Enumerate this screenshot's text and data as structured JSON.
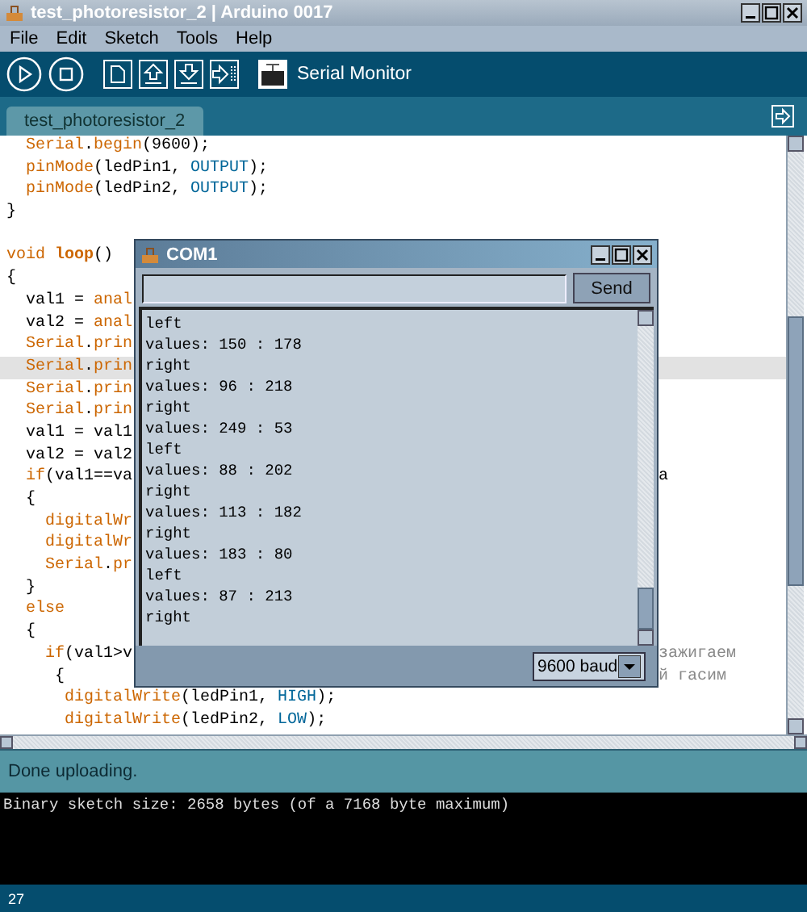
{
  "window": {
    "title": "test_photoresistor_2 | Arduino 0017"
  },
  "menu": [
    "File",
    "Edit",
    "Sketch",
    "Tools",
    "Help"
  ],
  "toolbar": {
    "buttons": [
      {
        "kind": "run"
      },
      {
        "kind": "stop"
      },
      {
        "kind": "new"
      },
      {
        "kind": "open"
      },
      {
        "kind": "save"
      },
      {
        "kind": "upload"
      }
    ],
    "serial_label": "Serial Monitor"
  },
  "tabs": [
    {
      "label": "test_photoresistor_2",
      "selected": true
    }
  ],
  "code": {
    "lines": [
      {
        "current": false,
        "parts": [
          {
            "text": "  Serial",
            "kind": "fn"
          },
          {
            "text": ".",
            "kind": "plain"
          },
          {
            "text": "begin",
            "kind": "fn"
          },
          {
            "text": "(9600);",
            "kind": "plain"
          }
        ]
      },
      {
        "current": false,
        "parts": [
          {
            "text": "  pinMode",
            "kind": "fn"
          },
          {
            "text": "(ledPin1, ",
            "kind": "plain"
          },
          {
            "text": "OUTPUT",
            "kind": "const"
          },
          {
            "text": ");",
            "kind": "plain"
          }
        ]
      },
      {
        "current": false,
        "parts": [
          {
            "text": "  pinMode",
            "kind": "fn"
          },
          {
            "text": "(ledPin2, ",
            "kind": "plain"
          },
          {
            "text": "OUTPUT",
            "kind": "const"
          },
          {
            "text": ");",
            "kind": "plain"
          }
        ]
      },
      {
        "current": false,
        "parts": [
          {
            "text": "}",
            "kind": "plain"
          }
        ]
      },
      {
        "current": false
      },
      {
        "current": false,
        "parts": [
          {
            "text": "void",
            "kind": "fn"
          },
          {
            "text": " loop",
            "kind": "bold"
          },
          {
            "text": "()",
            "kind": "plain"
          }
        ]
      },
      {
        "current": false,
        "parts": [
          {
            "text": "{",
            "kind": "plain"
          }
        ]
      },
      {
        "current": false,
        "parts": [
          {
            "text": "  val1 = ",
            "kind": "plain"
          },
          {
            "text": "anal",
            "kind": "fn"
          }
        ]
      },
      {
        "current": false,
        "parts": [
          {
            "text": "  val2 = ",
            "kind": "plain"
          },
          {
            "text": "anal",
            "kind": "fn"
          }
        ]
      },
      {
        "current": false,
        "parts": [
          {
            "text": "  Serial",
            "kind": "fn"
          },
          {
            "text": ".",
            "kind": "plain"
          },
          {
            "text": "prin",
            "kind": "fn"
          }
        ]
      },
      {
        "current": true,
        "parts": [
          {
            "text": "  Serial",
            "kind": "fn"
          },
          {
            "text": ".",
            "kind": "plain"
          },
          {
            "text": "prin",
            "kind": "fn"
          }
        ]
      },
      {
        "current": false,
        "parts": [
          {
            "text": "  Serial",
            "kind": "fn"
          },
          {
            "text": ".",
            "kind": "plain"
          },
          {
            "text": "prin",
            "kind": "fn"
          }
        ]
      },
      {
        "current": false,
        "parts": [
          {
            "text": "  Serial",
            "kind": "fn"
          },
          {
            "text": ".",
            "kind": "plain"
          },
          {
            "text": "prin",
            "kind": "fn"
          }
        ]
      },
      {
        "current": false,
        "parts": [
          {
            "text": "  val1 = val1",
            "kind": "plain"
          }
        ]
      },
      {
        "current": false,
        "parts": [
          {
            "text": "  val2 = val2",
            "kind": "plain"
          }
        ]
      },
      {
        "current": false,
        "parts": [
          {
            "text": "  if",
            "kind": "fn"
          },
          {
            "text": "(val1==va",
            "kind": "plain"
          }
        ],
        "tail": [
          {
            "text": "a",
            "kind": "plain"
          }
        ]
      },
      {
        "current": false,
        "parts": [
          {
            "text": "  {",
            "kind": "plain"
          }
        ]
      },
      {
        "current": false,
        "parts": [
          {
            "text": "    digitalWr",
            "kind": "fn"
          }
        ]
      },
      {
        "current": false,
        "parts": [
          {
            "text": "    digitalWr",
            "kind": "fn"
          }
        ]
      },
      {
        "current": false,
        "parts": [
          {
            "text": "    Serial",
            "kind": "fn"
          },
          {
            "text": ".",
            "kind": "plain"
          },
          {
            "text": "pr",
            "kind": "fn"
          }
        ]
      },
      {
        "current": false,
        "parts": [
          {
            "text": "  }",
            "kind": "plain"
          }
        ]
      },
      {
        "current": false,
        "parts": [
          {
            "text": "  else",
            "kind": "fn"
          }
        ]
      },
      {
        "current": false,
        "parts": [
          {
            "text": "  {",
            "kind": "plain"
          }
        ]
      },
      {
        "current": false,
        "parts": [
          {
            "text": "    if",
            "kind": "fn"
          },
          {
            "text": "(val1>v",
            "kind": "plain"
          }
        ],
        "tail": [
          {
            "text": "зажигаем",
            "kind": "comment"
          }
        ]
      },
      {
        "current": false,
        "parts": [
          {
            "text": "     {",
            "kind": "plain"
          }
        ],
        "tail": [
          {
            "text": "й гасим",
            "kind": "comment"
          }
        ]
      },
      {
        "current": false,
        "parts": [
          {
            "text": "      digitalWrite",
            "kind": "fn"
          },
          {
            "text": "(ledPin1, ",
            "kind": "plain"
          },
          {
            "text": "HIGH",
            "kind": "const"
          },
          {
            "text": ");",
            "kind": "plain"
          }
        ]
      },
      {
        "current": false,
        "parts": [
          {
            "text": "      digitalWrite",
            "kind": "fn"
          },
          {
            "text": "(ledPin2, ",
            "kind": "plain"
          },
          {
            "text": "LOW",
            "kind": "const"
          },
          {
            "text": ");",
            "kind": "plain"
          }
        ]
      }
    ]
  },
  "serial_monitor": {
    "title": "COM1",
    "send": "Send",
    "output": [
      "left",
      "values: 150 : 178",
      "right",
      "values: 96 : 218",
      "right",
      "values: 249 : 53",
      "left",
      "values: 88 : 202",
      "right",
      "values: 113 : 182",
      "right",
      "values: 183 : 80",
      "left",
      "values: 87 : 213",
      "right"
    ],
    "baud": "9600 baud"
  },
  "status": "Done uploading.",
  "console": [
    "Binary sketch size: 2658 bytes (of a 7168 byte maximum)"
  ],
  "line_number": "27"
}
